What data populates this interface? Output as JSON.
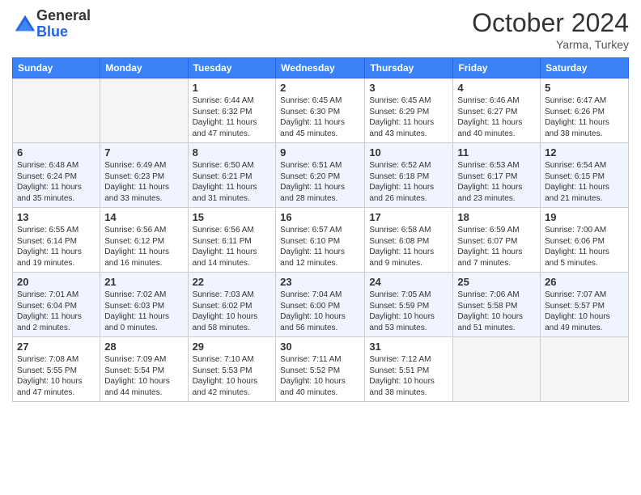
{
  "header": {
    "logo_general": "General",
    "logo_blue": "Blue",
    "month_title": "October 2024",
    "subtitle": "Yarma, Turkey"
  },
  "days_of_week": [
    "Sunday",
    "Monday",
    "Tuesday",
    "Wednesday",
    "Thursday",
    "Friday",
    "Saturday"
  ],
  "weeks": [
    [
      {
        "day": null
      },
      {
        "day": null
      },
      {
        "day": 1,
        "sunrise": "6:44 AM",
        "sunset": "6:32 PM",
        "daylight": "11 hours and 47 minutes."
      },
      {
        "day": 2,
        "sunrise": "6:45 AM",
        "sunset": "6:30 PM",
        "daylight": "11 hours and 45 minutes."
      },
      {
        "day": 3,
        "sunrise": "6:45 AM",
        "sunset": "6:29 PM",
        "daylight": "11 hours and 43 minutes."
      },
      {
        "day": 4,
        "sunrise": "6:46 AM",
        "sunset": "6:27 PM",
        "daylight": "11 hours and 40 minutes."
      },
      {
        "day": 5,
        "sunrise": "6:47 AM",
        "sunset": "6:26 PM",
        "daylight": "11 hours and 38 minutes."
      }
    ],
    [
      {
        "day": 6,
        "sunrise": "6:48 AM",
        "sunset": "6:24 PM",
        "daylight": "11 hours and 35 minutes."
      },
      {
        "day": 7,
        "sunrise": "6:49 AM",
        "sunset": "6:23 PM",
        "daylight": "11 hours and 33 minutes."
      },
      {
        "day": 8,
        "sunrise": "6:50 AM",
        "sunset": "6:21 PM",
        "daylight": "11 hours and 31 minutes."
      },
      {
        "day": 9,
        "sunrise": "6:51 AM",
        "sunset": "6:20 PM",
        "daylight": "11 hours and 28 minutes."
      },
      {
        "day": 10,
        "sunrise": "6:52 AM",
        "sunset": "6:18 PM",
        "daylight": "11 hours and 26 minutes."
      },
      {
        "day": 11,
        "sunrise": "6:53 AM",
        "sunset": "6:17 PM",
        "daylight": "11 hours and 23 minutes."
      },
      {
        "day": 12,
        "sunrise": "6:54 AM",
        "sunset": "6:15 PM",
        "daylight": "11 hours and 21 minutes."
      }
    ],
    [
      {
        "day": 13,
        "sunrise": "6:55 AM",
        "sunset": "6:14 PM",
        "daylight": "11 hours and 19 minutes."
      },
      {
        "day": 14,
        "sunrise": "6:56 AM",
        "sunset": "6:12 PM",
        "daylight": "11 hours and 16 minutes."
      },
      {
        "day": 15,
        "sunrise": "6:56 AM",
        "sunset": "6:11 PM",
        "daylight": "11 hours and 14 minutes."
      },
      {
        "day": 16,
        "sunrise": "6:57 AM",
        "sunset": "6:10 PM",
        "daylight": "11 hours and 12 minutes."
      },
      {
        "day": 17,
        "sunrise": "6:58 AM",
        "sunset": "6:08 PM",
        "daylight": "11 hours and 9 minutes."
      },
      {
        "day": 18,
        "sunrise": "6:59 AM",
        "sunset": "6:07 PM",
        "daylight": "11 hours and 7 minutes."
      },
      {
        "day": 19,
        "sunrise": "7:00 AM",
        "sunset": "6:06 PM",
        "daylight": "11 hours and 5 minutes."
      }
    ],
    [
      {
        "day": 20,
        "sunrise": "7:01 AM",
        "sunset": "6:04 PM",
        "daylight": "11 hours and 2 minutes."
      },
      {
        "day": 21,
        "sunrise": "7:02 AM",
        "sunset": "6:03 PM",
        "daylight": "11 hours and 0 minutes."
      },
      {
        "day": 22,
        "sunrise": "7:03 AM",
        "sunset": "6:02 PM",
        "daylight": "10 hours and 58 minutes."
      },
      {
        "day": 23,
        "sunrise": "7:04 AM",
        "sunset": "6:00 PM",
        "daylight": "10 hours and 56 minutes."
      },
      {
        "day": 24,
        "sunrise": "7:05 AM",
        "sunset": "5:59 PM",
        "daylight": "10 hours and 53 minutes."
      },
      {
        "day": 25,
        "sunrise": "7:06 AM",
        "sunset": "5:58 PM",
        "daylight": "10 hours and 51 minutes."
      },
      {
        "day": 26,
        "sunrise": "7:07 AM",
        "sunset": "5:57 PM",
        "daylight": "10 hours and 49 minutes."
      }
    ],
    [
      {
        "day": 27,
        "sunrise": "7:08 AM",
        "sunset": "5:55 PM",
        "daylight": "10 hours and 47 minutes."
      },
      {
        "day": 28,
        "sunrise": "7:09 AM",
        "sunset": "5:54 PM",
        "daylight": "10 hours and 44 minutes."
      },
      {
        "day": 29,
        "sunrise": "7:10 AM",
        "sunset": "5:53 PM",
        "daylight": "10 hours and 42 minutes."
      },
      {
        "day": 30,
        "sunrise": "7:11 AM",
        "sunset": "5:52 PM",
        "daylight": "10 hours and 40 minutes."
      },
      {
        "day": 31,
        "sunrise": "7:12 AM",
        "sunset": "5:51 PM",
        "daylight": "10 hours and 38 minutes."
      },
      {
        "day": null
      },
      {
        "day": null
      }
    ]
  ],
  "labels": {
    "sunrise": "Sunrise:",
    "sunset": "Sunset:",
    "daylight": "Daylight:"
  }
}
